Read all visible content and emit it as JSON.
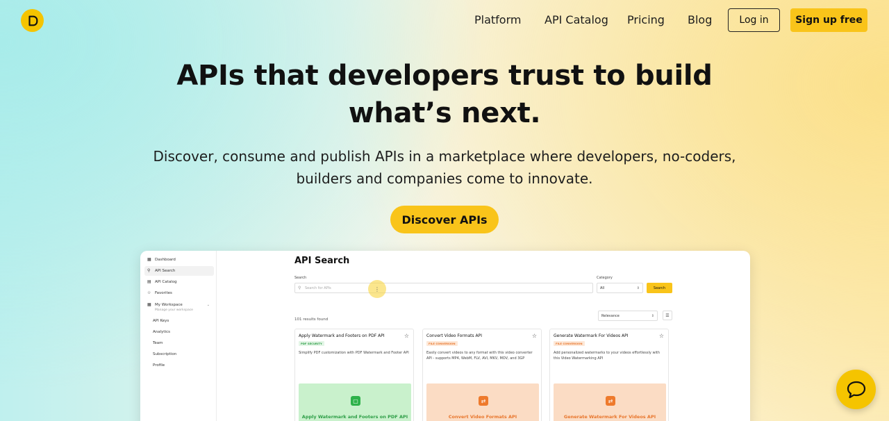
{
  "nav": {
    "links": [
      "Platform",
      "API Catalog",
      "Pricing",
      "Blog"
    ],
    "login_label": "Log in",
    "signup_label": "Sign up free"
  },
  "hero": {
    "title_line1": "APIs that developers trust to build",
    "title_line2": "what’s next.",
    "subtitle_line1": "Discover, consume and publish APIs in a marketplace where developers, no-coders,",
    "subtitle_line2": "builders and companies come to innovate.",
    "cta_label": "Discover APIs"
  },
  "preview": {
    "sidebar": {
      "items": [
        "Dashboard",
        "API Search",
        "API Catalog",
        "Favorites",
        "My Workspace"
      ],
      "workspace_hint": "Manage your workspace",
      "sub_items": [
        "API Keys",
        "Analytics",
        "Team",
        "Subscription",
        "Profile"
      ]
    },
    "page_title": "API Search",
    "search_label": "Search",
    "search_placeholder": "Search for APIs",
    "category_label": "Category",
    "category_value": "All",
    "search_button": "Search",
    "results_count": "101 results found",
    "sort_value": "Relevance",
    "cards": [
      {
        "title": "Apply Watermark and Footers on PDF API",
        "badge": "PDF SECURITY",
        "description": "Simplify PDF customization with PDF Watermark and Footer API",
        "thumb_label": "Apply Watermark and Footers on PDF API"
      },
      {
        "title": "Convert Video Formats API",
        "badge": "FILE CONVERSION",
        "description": "Easily convert videos to any format with this video converter API - supports MP4, WebM, FLV, AVI, MKV, MOV, and 3GP",
        "thumb_label": "Convert Video Formats API"
      },
      {
        "title": "Generate Watermark For Videos API",
        "badge": "FILE CONVERSION",
        "description": "Add personalized watermarks to your videos effortlessly with this Video Watermarking API",
        "thumb_label": "Generate Watermark For Videos API"
      }
    ]
  },
  "colors": {
    "brand_yellow": "#f9c41a",
    "green_badge": "#2e9e47",
    "orange_badge": "#e8772e"
  },
  "icons": {
    "logo": "logo-icon",
    "chat": "chat-icon"
  }
}
